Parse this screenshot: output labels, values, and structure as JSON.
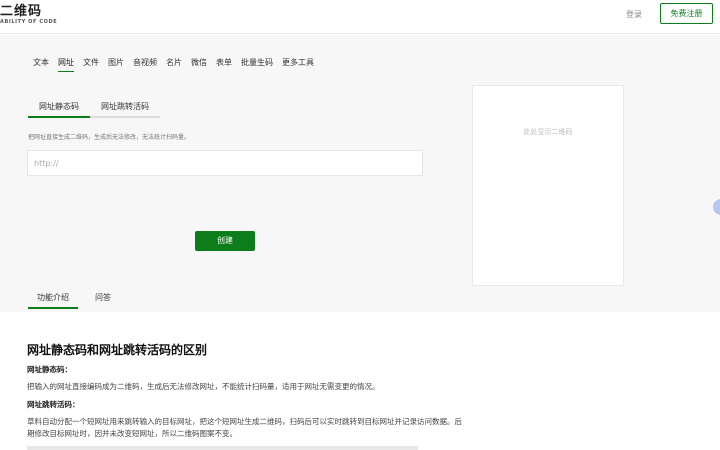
{
  "header": {
    "logo_text": "二维码",
    "logo_sub": "ABILITY OF CODE",
    "login": "登录",
    "signup": "免费注册"
  },
  "type_tabs": [
    "文本",
    "网址",
    "文件",
    "图片",
    "音视频",
    "名片",
    "微信",
    "表单",
    "批量生码",
    "更多工具"
  ],
  "active_type_tab": "网址",
  "sub_tabs": [
    "网址静态码",
    "网址跳转活码"
  ],
  "active_sub_tab": "网址静态码",
  "hint": "把网址直接生成二维码，生成后无法修改，无法统计扫码量。",
  "url_input": {
    "placeholder": "http://",
    "value": ""
  },
  "create_button": "创建",
  "qr_placeholder": "此处显示二维码",
  "info_tabs": [
    "功能介绍",
    "问答"
  ],
  "active_info_tab": "功能介绍",
  "article": {
    "title": "网址静态码和网址跳转活码的区别",
    "sections": [
      {
        "heading": "网址静态码：",
        "text": "把输入的网址直接编码成为二维码，生成后无法修改网址，不能统计扫码量，适用于网址无需变更的情况。"
      },
      {
        "heading": "网址跳转活码：",
        "text": "草料自动分配一个短网址用来跳转输入的目标网址，把这个短网址生成二维码，扫码后可以实时跳转到目标网址并记录访问数据。后期修改目标网址时，因并未改变短网址，所以二维码图案不变。"
      }
    ]
  },
  "colors": {
    "brand_green": "#0c7d1a",
    "panel_bg": "#f7f7f7",
    "handle_blue": "#b9c6ef"
  }
}
